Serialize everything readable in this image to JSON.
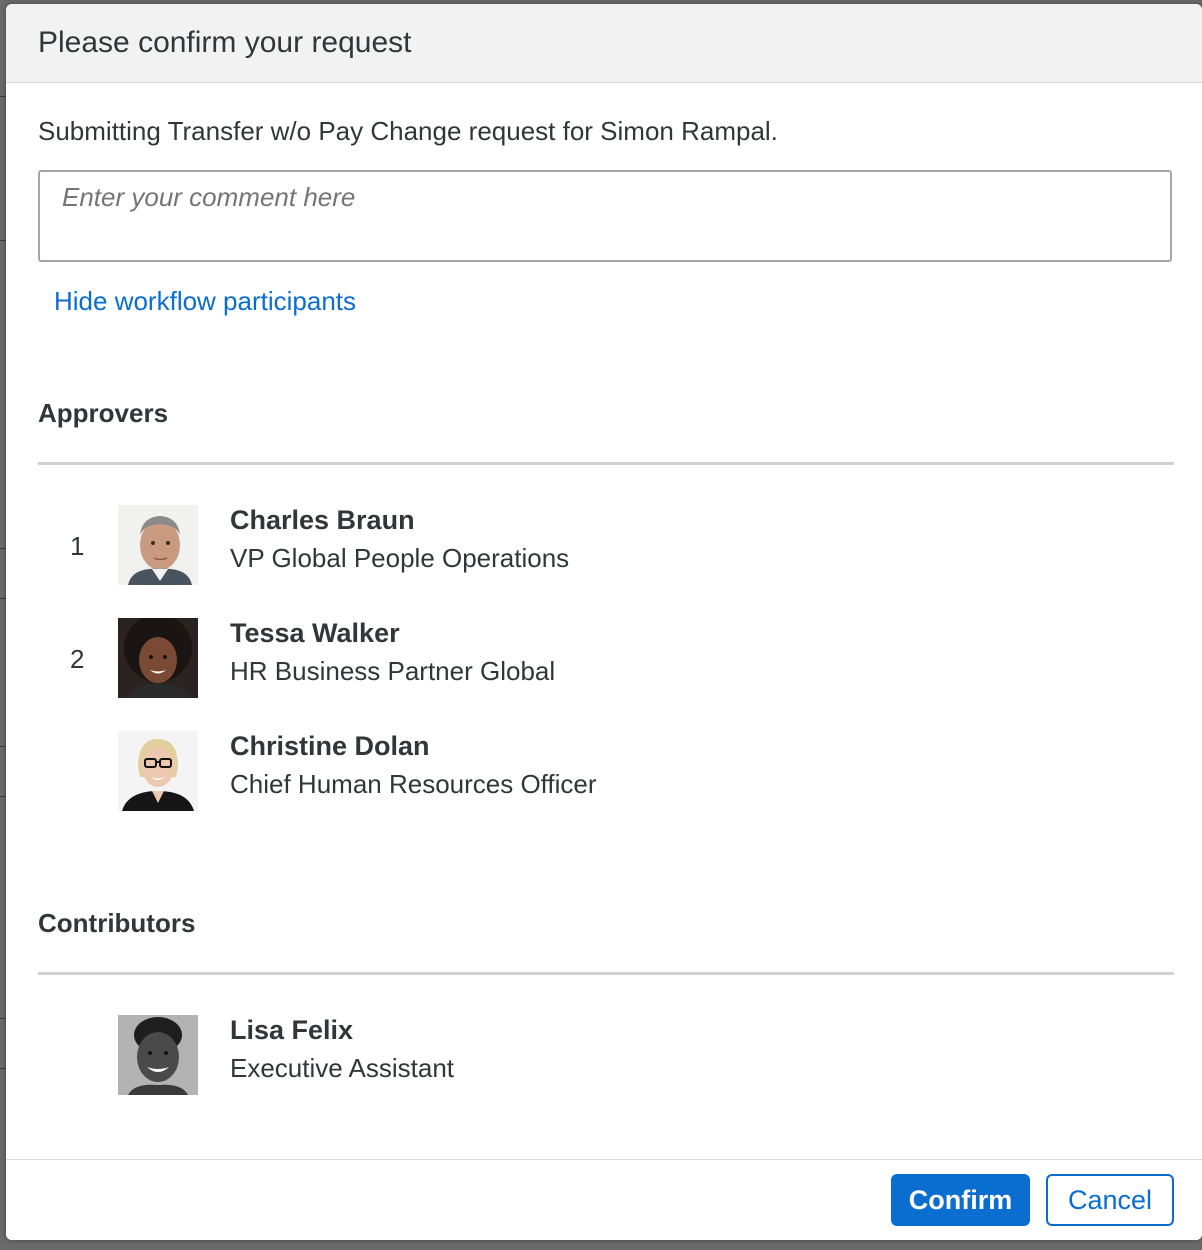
{
  "dialog": {
    "title": "Please confirm your request",
    "intro": "Submitting Transfer w/o Pay Change request for Simon Rampal.",
    "comment_placeholder": "Enter your comment here",
    "toggle_link": "Hide workflow participants"
  },
  "approvers": {
    "title": "Approvers",
    "items": [
      {
        "step": "1",
        "name": "Charles Braun",
        "role": "VP Global People Operations",
        "avatar": "avatar-photo"
      },
      {
        "step": "2",
        "name": "Tessa Walker",
        "role": "HR Business Partner Global",
        "avatar": "avatar-photo"
      },
      {
        "step": "",
        "name": "Christine Dolan",
        "role": "Chief Human Resources Officer",
        "avatar": "avatar-photo"
      }
    ]
  },
  "contributors": {
    "title": "Contributors",
    "items": [
      {
        "name": "Lisa Felix",
        "role": "Executive Assistant",
        "avatar": "avatar-photo"
      }
    ]
  },
  "footer": {
    "confirm_label": "Confirm",
    "cancel_label": "Cancel"
  },
  "colors": {
    "accent": "#0a6ed1",
    "text": "#32363a",
    "header_bg": "#f2f2f2"
  }
}
